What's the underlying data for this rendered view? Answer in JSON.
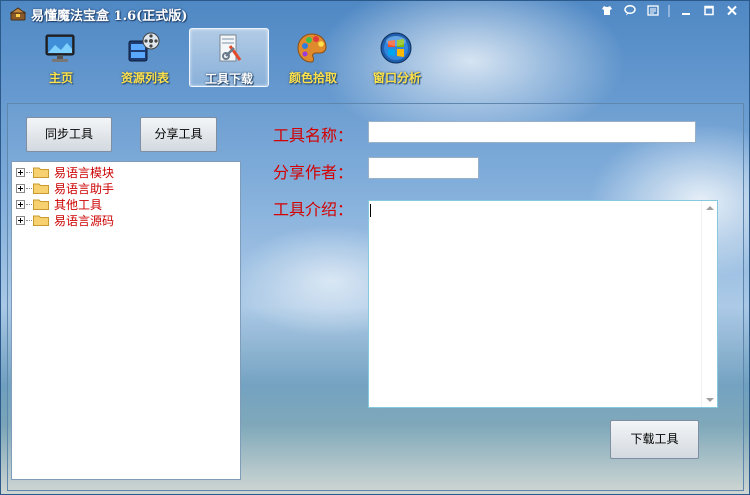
{
  "app": {
    "title": "易懂魔法宝盒 1.6(正式版)"
  },
  "system_buttons": [
    {
      "name": "skin",
      "icon": "shirt-icon"
    },
    {
      "name": "feedback",
      "icon": "chat-bubble-icon"
    },
    {
      "name": "menu",
      "icon": "menu-icon"
    },
    {
      "name": "separator",
      "icon": "divider-icon"
    },
    {
      "name": "minimize",
      "icon": "minimize-icon"
    },
    {
      "name": "maximize",
      "icon": "maximize-icon"
    },
    {
      "name": "close",
      "icon": "close-icon"
    }
  ],
  "toolbar": {
    "items": [
      {
        "label": "主页",
        "icon": "monitor-icon",
        "active": false
      },
      {
        "label": "资源列表",
        "icon": "film-reel-icon",
        "active": false
      },
      {
        "label": "工具下载",
        "icon": "tools-download-icon",
        "active": true
      },
      {
        "label": "颜色拾取",
        "icon": "palette-icon",
        "active": false
      },
      {
        "label": "窗口分析",
        "icon": "windows-orb-icon",
        "active": false
      }
    ]
  },
  "left": {
    "sync_button": "同步工具",
    "share_button": "分享工具",
    "tree": [
      {
        "label": "易语言模块"
      },
      {
        "label": "易语言助手"
      },
      {
        "label": "其他工具"
      },
      {
        "label": "易语言源码"
      }
    ]
  },
  "form": {
    "name_label": "工具名称：",
    "name_value": "",
    "author_label": "分享作者：",
    "author_value": "",
    "intro_label": "工具介绍：",
    "intro_value": "",
    "download_button": "下载工具"
  },
  "colors": {
    "label_red": "#d40000",
    "tree_text": "#cc0000",
    "toolbar_label": "#ffe14a",
    "active_label": "#ffffff"
  }
}
